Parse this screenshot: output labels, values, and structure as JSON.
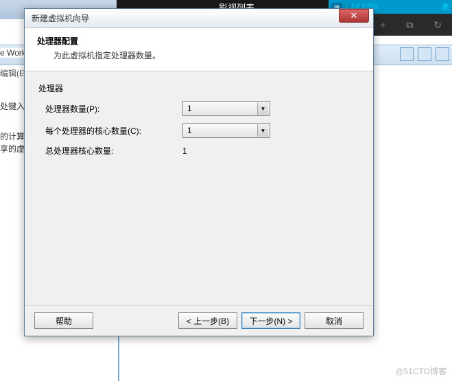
{
  "background": {
    "top_center": "影视列表",
    "speed": "64 KB/s",
    "list_suffix": "表",
    "left_texts": {
      "works": "e Works",
      "edit": "编辑(E)",
      "input": "处键入P",
      "computer": "的计算札",
      "shared": "享的虚拟"
    }
  },
  "dialog": {
    "title": "新建虚拟机向导",
    "header": {
      "title": "处理器配置",
      "subtitle": "为此虚拟机指定处理器数量。"
    },
    "content": {
      "section_label": "处理器",
      "rows": {
        "num_processors": {
          "label": "处理器数量(P):",
          "value": "1"
        },
        "cores_per": {
          "label": "每个处理器的核心数量(C):",
          "value": "1"
        },
        "total": {
          "label": "总处理器核心数量:",
          "value": "1"
        }
      }
    },
    "footer": {
      "help": "帮助",
      "back": "< 上一步(B)",
      "next": "下一步(N) >",
      "cancel": "取消"
    }
  },
  "watermark": "@51CTO博客"
}
